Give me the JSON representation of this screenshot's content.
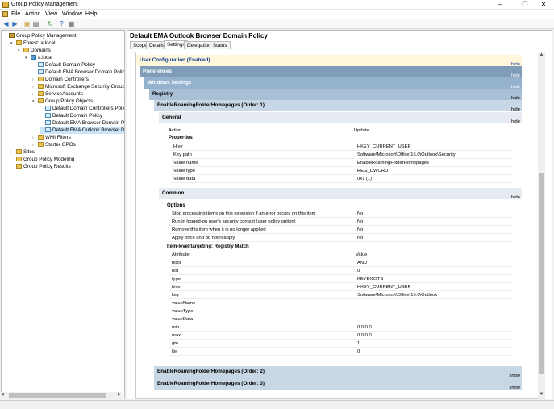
{
  "window": {
    "title": "Group Policy Management",
    "minimize": "–",
    "maximize": "❐",
    "close": "✕"
  },
  "menu": [
    "File",
    "Action",
    "View",
    "Window",
    "Help"
  ],
  "tree": [
    {
      "label": "Group Policy Management",
      "depth": 0,
      "icon": "root",
      "exp": ""
    },
    {
      "label": "Forest: a.local",
      "depth": 1,
      "icon": "folder",
      "exp": "▾"
    },
    {
      "label": "Domains",
      "depth": 2,
      "icon": "folder",
      "exp": "▾"
    },
    {
      "label": "a.local",
      "depth": 3,
      "icon": "domain",
      "exp": "▾"
    },
    {
      "label": "Default Domain Policy",
      "depth": 4,
      "icon": "gpo",
      "exp": ""
    },
    {
      "label": "Default EMA Browser Domain Policy",
      "depth": 4,
      "icon": "gpo",
      "exp": ""
    },
    {
      "label": "Domain Controllers",
      "depth": 4,
      "icon": "folder",
      "exp": "›"
    },
    {
      "label": "Microsoft Exchange Security Groups",
      "depth": 4,
      "icon": "folder",
      "exp": "›"
    },
    {
      "label": "ServiceAccounts",
      "depth": 4,
      "icon": "folder",
      "exp": "›"
    },
    {
      "label": "Group Policy Objects",
      "depth": 4,
      "icon": "folder",
      "exp": "▾"
    },
    {
      "label": "Default Domain Controllers Policy",
      "depth": 5,
      "icon": "gpo",
      "exp": ""
    },
    {
      "label": "Default Domain Policy",
      "depth": 5,
      "icon": "gpo",
      "exp": ""
    },
    {
      "label": "Default EMA Browser Domain Polic",
      "depth": 5,
      "icon": "gpo",
      "exp": ""
    },
    {
      "label": "Default EMA Outlook Browser Dom",
      "depth": 5,
      "icon": "gpo",
      "exp": "",
      "selected": true
    },
    {
      "label": "WMI Filters",
      "depth": 4,
      "icon": "folder",
      "exp": "›"
    },
    {
      "label": "Starter GPOs",
      "depth": 4,
      "icon": "folder",
      "exp": "›"
    },
    {
      "label": "Sites",
      "depth": 1,
      "icon": "folder",
      "exp": "›"
    },
    {
      "label": "Group Policy Modeling",
      "depth": 1,
      "icon": "folder",
      "exp": ""
    },
    {
      "label": "Group Policy Results",
      "depth": 1,
      "icon": "folder",
      "exp": ""
    }
  ],
  "policy_title": "Default EMA Outlook Browser Domain Policy",
  "tabs": [
    "Scope",
    "Details",
    "Settings",
    "Delegation",
    "Status"
  ],
  "report": {
    "user_config": "User Configuration (Enabled)",
    "preferences": "Preferences",
    "windows_settings": "Windows Settings",
    "registry": "Registry",
    "item1": "EnableRoamingFolderHomepages (Order: 1)",
    "general": "General",
    "action_label": "Action",
    "action_value": "Update",
    "properties": "Properties",
    "props": [
      [
        "Hive",
        "HKEY_CURRENT_USER"
      ],
      [
        "Key path",
        "Software\\Microsoft\\Office\\16.0\\Outlook\\Security"
      ],
      [
        "Value name",
        "EnableRoamingFolderHomepages"
      ],
      [
        "Value type",
        "REG_DWORD"
      ],
      [
        "Value data",
        "0x1 (1)"
      ]
    ],
    "common": "Common",
    "options": "Options",
    "opts": [
      [
        "Stop processing items on this extension if an error occurs on this item",
        "No"
      ],
      [
        "Run in logged-on user's security context (user policy option)",
        "No"
      ],
      [
        "Remove this item when it is no longer applied",
        "No"
      ],
      [
        "Apply once and do not reapply",
        "No"
      ]
    ],
    "targeting": "Item-level targeting: Registry Match",
    "attr_header": "Attribute",
    "value_header": "Value",
    "attrs": [
      [
        "bool",
        "AND"
      ],
      [
        "not",
        "0"
      ],
      [
        "type",
        "KEYEXISTS"
      ],
      [
        "hive",
        "HKEY_CURRENT_USER"
      ],
      [
        "key",
        "Software\\Microsoft\\Office\\16.0\\Outlook"
      ],
      [
        "valueName",
        ""
      ],
      [
        "valueType",
        ""
      ],
      [
        "valueData",
        ""
      ],
      [
        "min",
        "0.0.0.0"
      ],
      [
        "max",
        "0.0.0.0"
      ],
      [
        "gte",
        "1"
      ],
      [
        "lte",
        "0"
      ]
    ],
    "item2": "EnableRoamingFolderHomepages (Order: 2)",
    "item3": "EnableRoamingFolderHomepages (Order: 3)",
    "hide": "hide",
    "show": "show"
  },
  "colors": {
    "user_band": "#fff6dc",
    "preferences_band": "#7f9db9",
    "sub_band": "#94b2ce",
    "item_band": "#c8d7e5",
    "inner_band": "#e6ebf1"
  }
}
